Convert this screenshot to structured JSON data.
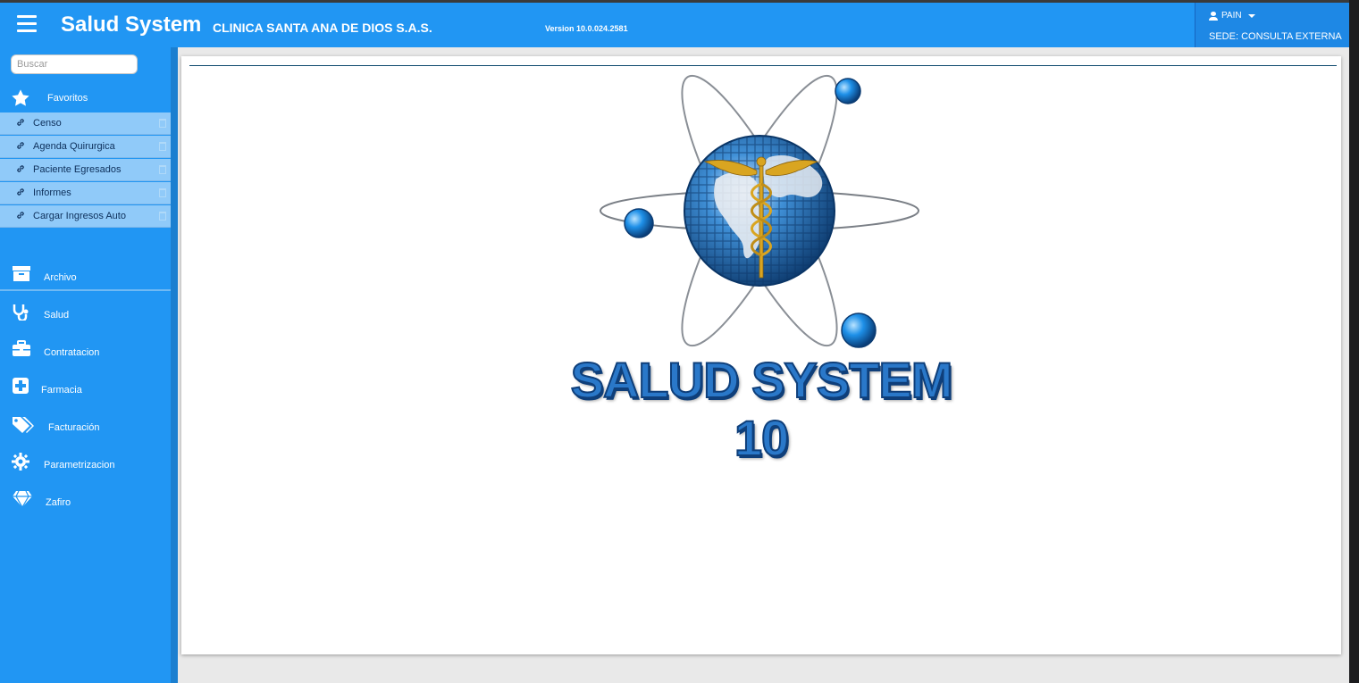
{
  "header": {
    "brand": "Salud System",
    "clinic": "CLINICA SANTA ANA DE DIOS S.A.S.",
    "version": "Version 10.0.024.2581",
    "user": "PAIN",
    "sede": "SEDE: CONSULTA EXTERNA"
  },
  "sidebar": {
    "search_placeholder": "Buscar",
    "favorites_label": "Favoritos",
    "favorites": [
      {
        "label": "Censo"
      },
      {
        "label": "Agenda Quirurgica"
      },
      {
        "label": "Paciente Egresados"
      },
      {
        "label": "Informes"
      },
      {
        "label": "Cargar Ingresos Auto"
      }
    ],
    "menu": [
      {
        "label": "Archivo",
        "icon": "archive-icon"
      },
      {
        "label": "Salud",
        "icon": "stethoscope-icon"
      },
      {
        "label": "Contratacion",
        "icon": "briefcase-icon"
      },
      {
        "label": "Farmacia",
        "icon": "plus-square-icon"
      },
      {
        "label": "Facturación",
        "icon": "tags-icon"
      },
      {
        "label": "Parametrizacion",
        "icon": "gear-icon"
      },
      {
        "label": "Zafiro",
        "icon": "diamond-icon"
      }
    ]
  },
  "main": {
    "logo_text": "SALUD SYSTEM 10"
  },
  "colors": {
    "primary": "#2196f3",
    "favorite_bg": "#90caf9",
    "user_bg": "#1e88e5"
  }
}
